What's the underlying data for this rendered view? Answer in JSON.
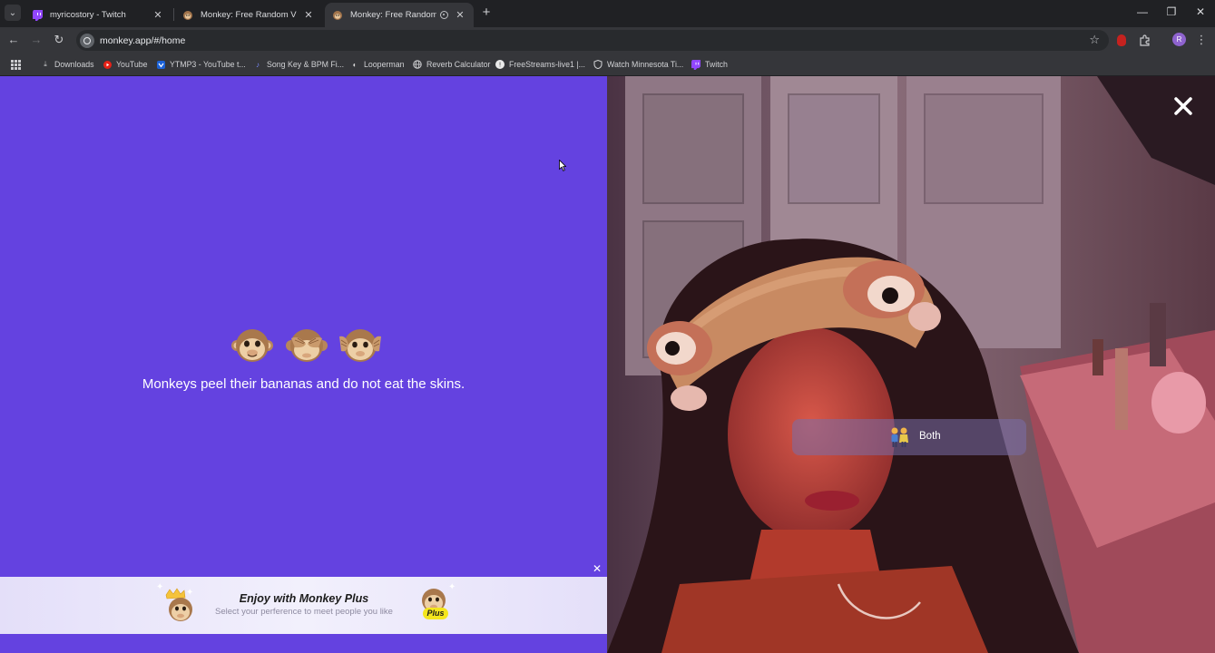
{
  "tabs": [
    {
      "title": "myricostory - Twitch",
      "favicon": "twitch-icon",
      "active": false
    },
    {
      "title": "Monkey: Free Random Video C",
      "favicon": "monkey-icon",
      "active": false
    },
    {
      "title": "Monkey: Free Random Vide",
      "favicon": "monkey-icon",
      "active": true
    }
  ],
  "omnibox": {
    "url": "monkey.app/#/home"
  },
  "bookmarks": [
    {
      "label": "Downloads",
      "icon": "download-icon"
    },
    {
      "label": "YouTube",
      "icon": "youtube-icon"
    },
    {
      "label": "YTMP3 - YouTube t...",
      "icon": "ytmp3-icon"
    },
    {
      "label": "Song Key & BPM Fi...",
      "icon": "music-note-icon"
    },
    {
      "label": "Looperman",
      "icon": "looperman-icon"
    },
    {
      "label": "Reverb Calculator",
      "icon": "globe-icon"
    },
    {
      "label": "FreeStreams-live1 |...",
      "icon": "freestreams-icon"
    },
    {
      "label": "Watch Minnesota Ti...",
      "icon": "shield-icon"
    },
    {
      "label": "Twitch",
      "icon": "twitch-icon"
    }
  ],
  "profile": {
    "initial": "R",
    "color": "#8e63ce"
  },
  "left_panel": {
    "background": "#6442e0",
    "emojis": [
      "monkey-face-icon",
      "see-no-evil-monkey-icon",
      "hear-no-evil-monkey-icon"
    ],
    "fact": "Monkeys peel their bananas and do not eat the skins."
  },
  "promo": {
    "title": "Enjoy with Monkey Plus",
    "subtitle": "Select your perference to meet people you like",
    "badge": "Plus"
  },
  "video": {
    "gender_filter": "Both"
  }
}
